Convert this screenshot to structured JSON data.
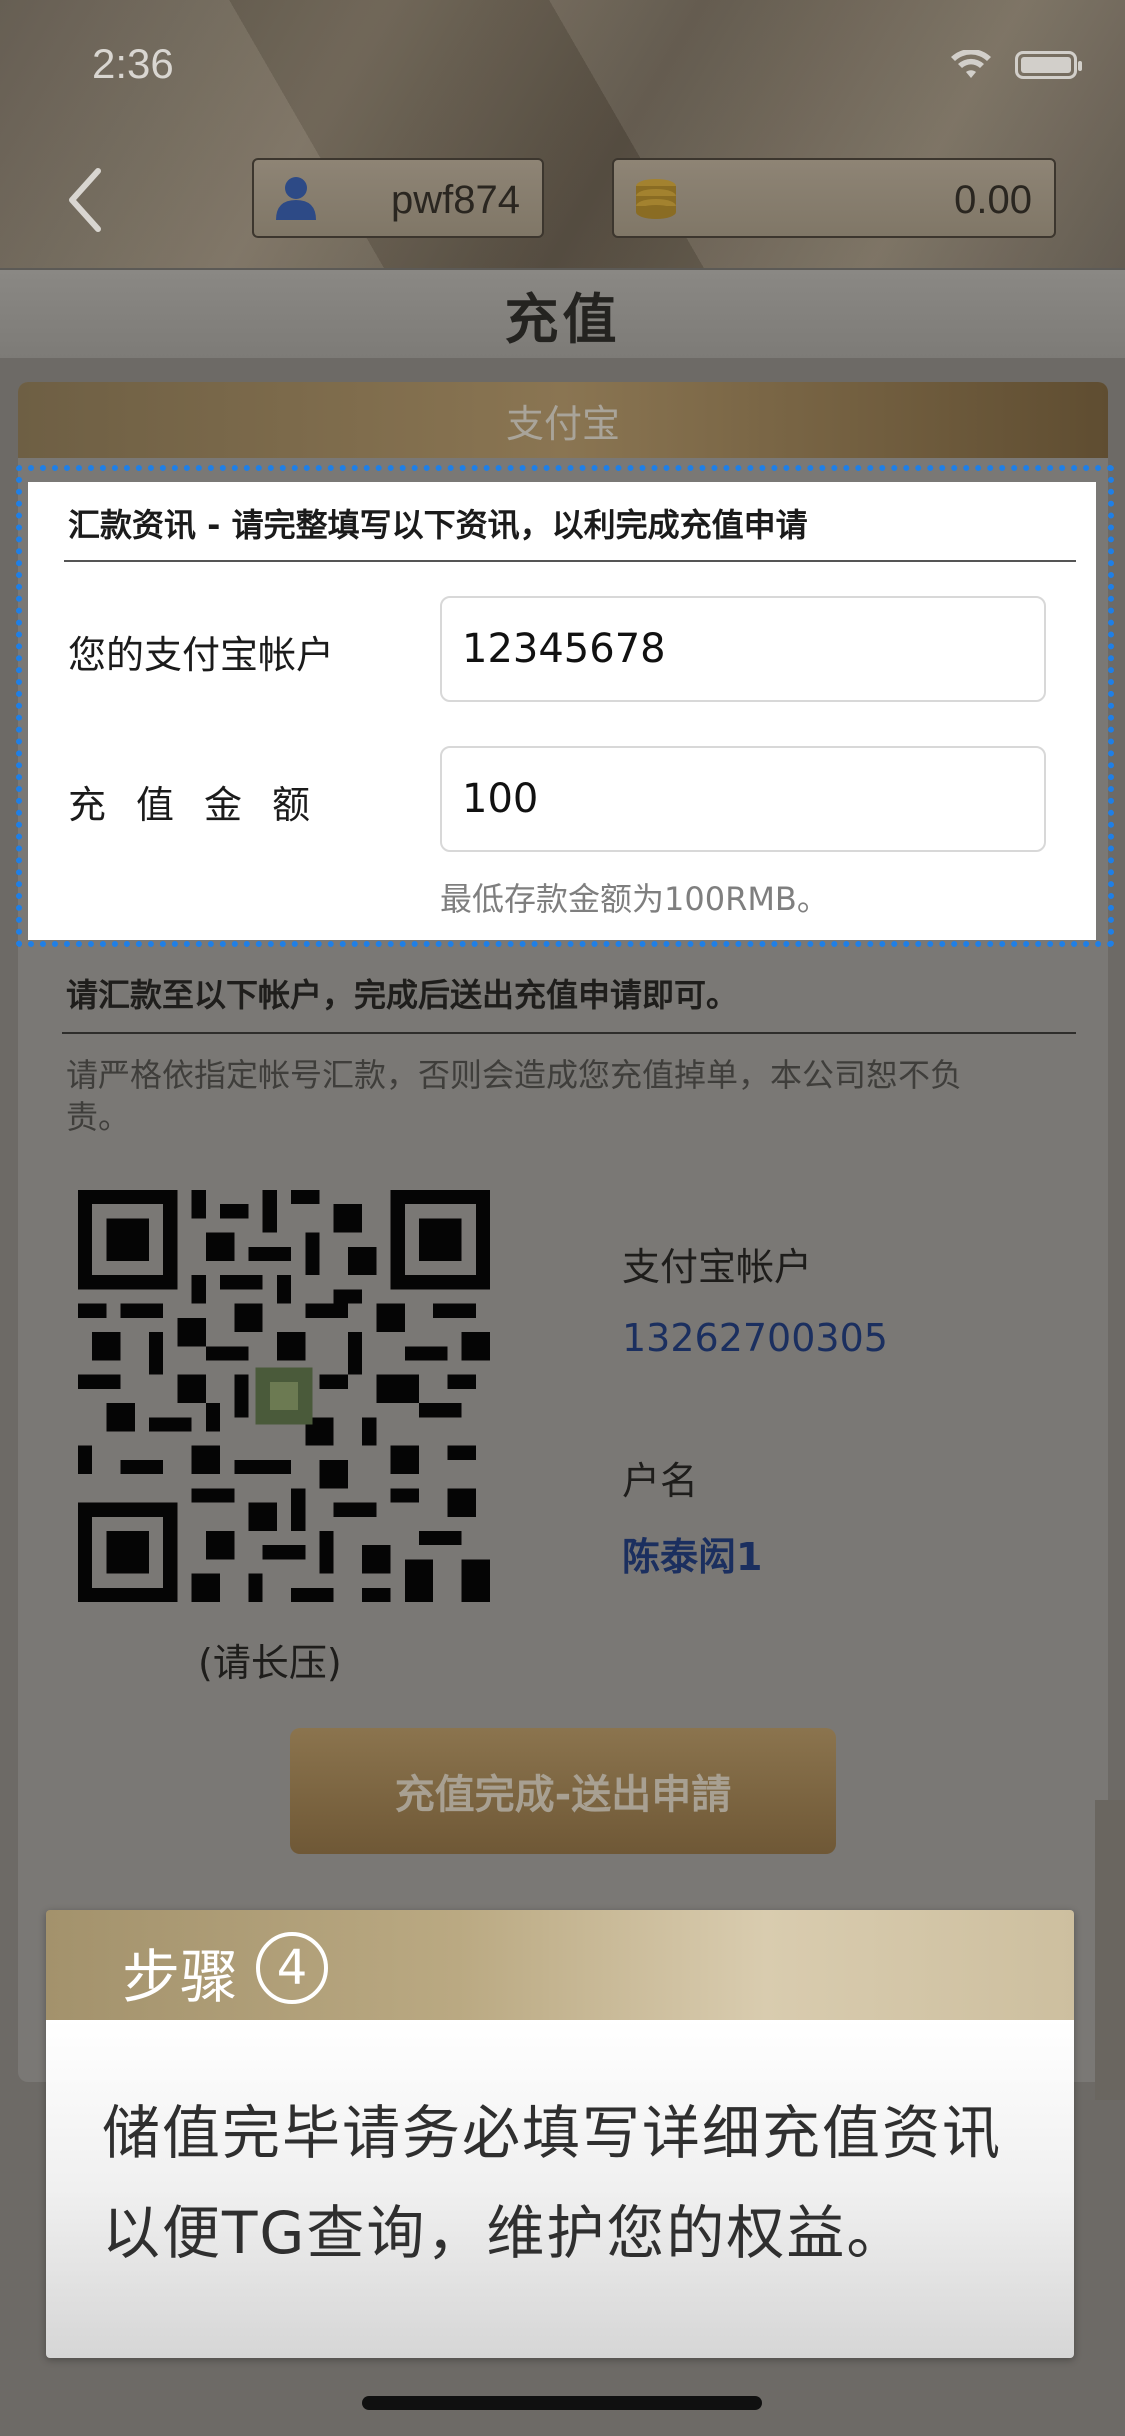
{
  "status": {
    "time": "2:36"
  },
  "header": {
    "username": "pwf874",
    "balance": "0.00",
    "title": "充值",
    "payment_tab": "支付宝"
  },
  "form": {
    "title": "汇款资讯 - 请完整填写以下资讯，以利完成充值申请",
    "account_label": "您的支付宝帐户",
    "account_value": "12345678",
    "amount_label": "充值金额",
    "amount_value": "100",
    "hint": "最低存款金额为100RMB。"
  },
  "remit": {
    "title": "请汇款至以下帐户，完成后送出充值申请即可。",
    "note": "请严格依指定帐号汇款，否则会造成您充值掉单，本公司恕不负责。",
    "qr_caption": "(请长压)",
    "account_label": "支付宝帐户",
    "account_value": "13262700305",
    "name_label": "户名",
    "name_value": "陈泰闳1",
    "submit_label": "充值完成-送出申請"
  },
  "popup": {
    "step_label": "步骤",
    "step_number": "4",
    "line1": "储值完毕请务必填写详细充值资讯",
    "line2": "以便TG查询，维护您的权益。"
  },
  "colors": {
    "highlight_border": "#1f7fe6",
    "link_blue": "#1b2f5f",
    "gold": "#8b744e"
  }
}
